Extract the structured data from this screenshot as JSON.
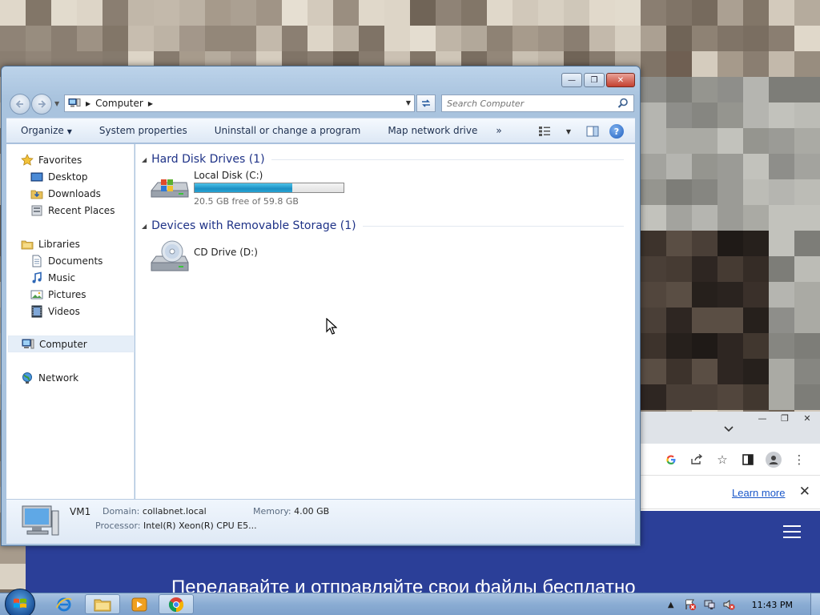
{
  "desktop": {
    "mosaic_colors": [
      "#6f5f52",
      "#cfc6b8",
      "#8c8073",
      "#d8d0c2",
      "#9a8e80",
      "#c3b9ab",
      "#7d7064",
      "#e2dbcd",
      "#a79b8c",
      "#bdb3a5",
      "#8f8376",
      "#d1c8ba",
      "#766a5d",
      "#c9c0b2",
      "#9e9284",
      "#ddd5c7",
      "#857a6d",
      "#b5ab9d",
      "#a09486",
      "#e8e1d4",
      "#7a6e61",
      "#c7bdaf",
      "#938779",
      "#d5ccbe",
      "#6c6054",
      "#bfb5a7",
      "#aba092",
      "#dcd3c5",
      "#8a7e71",
      "#cec5b7",
      "#7f7366",
      "#e0d8ca",
      "#c1b7a9",
      "#958a7c",
      "#d9d1c3",
      "#827668",
      "#b8ae9f",
      "#a69a8b",
      "#e4ddd0",
      "#796d60",
      "#cbc1b3",
      "#8e8274",
      "#d3cabc",
      "#706457",
      "#c6bcae",
      "#9b8f81",
      "#dad2c4",
      "#877b6e",
      "#b2a89a",
      "#a3978a",
      "#e6dfd2",
      "#7c7063",
      "#c4baac",
      "#918578",
      "#d6cdbf",
      "#6e6255",
      "#bcb2a4",
      "#a89c8e",
      "#ded6c8",
      "#8b7f72",
      "#cfc7b9",
      "#807467",
      "#e1d9cb",
      "#988d7f"
    ],
    "dark_colors": [
      "#2e2622",
      "#3d332c",
      "#1f1a17",
      "#4a3f37",
      "#352c26",
      "#5a4e44",
      "#26201c",
      "#463b33",
      "#3a302a",
      "#52463d",
      "#2a231f",
      "#41372f"
    ],
    "gray_colors": [
      "#8e8e8a",
      "#a3a39e",
      "#7d7d78",
      "#b5b5b0",
      "#95958f",
      "#c2c2bc",
      "#868681",
      "#aaaaa4",
      "#9b9b96",
      "#bcbcb6"
    ]
  },
  "chrome_window": {
    "window_buttons": [
      "—",
      "❐",
      "✕"
    ],
    "tab_list_icon": "chevron-down-icon",
    "learn_more": "Learn more",
    "info_close": "✕",
    "hero_text": "Передавайте и отправляйте свои файлы бесплатно"
  },
  "explorer": {
    "window_controls": {
      "minimize": "—",
      "maximize": "❐",
      "close": "✕"
    },
    "address": {
      "crumbs": [
        "Computer"
      ]
    },
    "search": {
      "placeholder": "Search Computer"
    },
    "commands": {
      "organize": "Organize",
      "system_properties": "System properties",
      "uninstall": "Uninstall or change a program",
      "map_drive": "Map network drive",
      "more": "»"
    },
    "nav": {
      "favorites": {
        "label": "Favorites",
        "items": [
          "Desktop",
          "Downloads",
          "Recent Places"
        ]
      },
      "libraries": {
        "label": "Libraries",
        "items": [
          "Documents",
          "Music",
          "Pictures",
          "Videos"
        ]
      },
      "computer": "Computer",
      "network": "Network"
    },
    "groups": {
      "hdd": {
        "header": "Hard Disk Drives (1)",
        "drive_name": "Local Disk (C:)",
        "free_text": "20.5 GB free of 59.8 GB",
        "used_fraction": 0.657
      },
      "removable": {
        "header": "Devices with Removable Storage (1)",
        "drive_name": "CD Drive (D:)"
      }
    },
    "details": {
      "name": "VM1",
      "domain_label": "Domain:",
      "domain_value": "collabnet.local",
      "memory_label": "Memory:",
      "memory_value": "4.00 GB",
      "processor_label": "Processor:",
      "processor_value": "Intel(R) Xeon(R) CPU E5..."
    }
  },
  "taskbar": {
    "apps": [
      "internet-explorer-icon",
      "windows-explorer-icon",
      "media-player-icon",
      "chrome-icon"
    ],
    "tray_icons": [
      "show-hidden-icons",
      "action-center-icon",
      "network-icon",
      "volume-icon"
    ],
    "clock": "11:43 PM"
  }
}
